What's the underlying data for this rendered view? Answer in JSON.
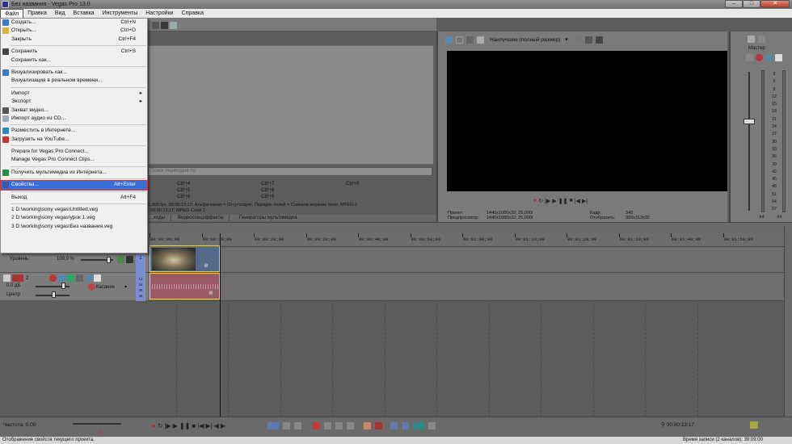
{
  "window": {
    "title": "Без названия - Vegas Pro 13.0",
    "minimize": "–",
    "maximize": "□",
    "close": "✕"
  },
  "menubar": [
    "Файл",
    "Правка",
    "Вид",
    "Вставка",
    "Инструменты",
    "Настройки",
    "Справка"
  ],
  "file_menu": {
    "items": [
      {
        "label": "Создать...",
        "shortcut": "Ctrl+N",
        "icon": "new-doc-icon"
      },
      {
        "label": "Открыть...",
        "shortcut": "Ctrl+O",
        "icon": "open-folder-icon"
      },
      {
        "label": "Закрыть",
        "shortcut": "Ctrl+F4"
      },
      {
        "sep": true
      },
      {
        "label": "Сохранить",
        "shortcut": "Ctrl+S",
        "icon": "save-icon"
      },
      {
        "label": "Сохранить как..."
      },
      {
        "sep": true
      },
      {
        "label": "Визуализировать как...",
        "icon": "render-icon"
      },
      {
        "label": "Визуализация в реальном времени..."
      },
      {
        "sep": true
      },
      {
        "label": "Импорт",
        "submenu": true
      },
      {
        "label": "Экспорт",
        "submenu": true
      },
      {
        "label": "Захват видео...",
        "icon": "capture-icon"
      },
      {
        "label": "Импорт аудио из CD...",
        "icon": "cd-icon"
      },
      {
        "sep": true
      },
      {
        "label": "Разместить в Интернете...",
        "icon": "web-icon"
      },
      {
        "label": "Загрузить на YouTube...",
        "icon": "youtube-icon"
      },
      {
        "sep": true
      },
      {
        "label": "Prepare for Vegas Pro Connect..."
      },
      {
        "label": "Manage Vegas Pro Connect Clips..."
      },
      {
        "sep": true
      },
      {
        "label": "Получить мультимедиа из Интернета...",
        "icon": "download-icon"
      },
      {
        "sep": true
      },
      {
        "label": "Свойства...",
        "shortcut": "Alt+Enter",
        "icon": "properties-icon",
        "highlight": true
      },
      {
        "sep": true
      },
      {
        "label": "Выход",
        "shortcut": "Alt+F4"
      },
      {
        "sep": true
      },
      {
        "label": "1 D:\\working\\sony vegas\\Untitled.veg"
      },
      {
        "label": "2 D:\\working\\sony vegas\\урок 1.veg"
      },
      {
        "label": "3 D:\\working\\sony vegas\\Без названия.veg"
      }
    ]
  },
  "explorer": {
    "search_placeholder": "Поиск переходов по",
    "shortcuts": [
      [
        "Ctrl+4",
        "Ctrl+7",
        "Ctrl+0"
      ],
      [
        "Ctrl+5",
        "Ctrl+8",
        ""
      ],
      [
        "Ctrl+6",
        "Ctrl+9",
        ""
      ]
    ],
    "info_line1": "5,000 fps; 00:00:13;17; Альфа-канал = Отсутствует; Порядок полей = Сначала верхнее поле; MPEG-2",
    "info_line2": "; 00:00:13;17; MPEG Слой 2",
    "tabs": [
      "...ходы",
      "Видеоспецэффекты",
      "Генераторы мультимедиа"
    ]
  },
  "preview": {
    "quality": "Наилучшее (полный размер)",
    "project_label": "Проект:",
    "project_value": "1440x1080x32; 25,000i",
    "preview_label": "Предпросмотр:",
    "preview_value": "1440x1080x32; 25,000i",
    "frame_label": "Кадр:",
    "frame_value": "340",
    "display_label": "Отобразить:",
    "display_value": "389x313x32"
  },
  "master": {
    "title": "Мастер",
    "scale": [
      "3",
      "6",
      "9",
      "12",
      "15",
      "18",
      "21",
      "24",
      "27",
      "30",
      "33",
      "36",
      "39",
      "42",
      "45",
      "48",
      "51",
      "54",
      "57"
    ],
    "levels": [
      "-Inf.",
      "-Inf."
    ]
  },
  "timeline": {
    "timecode": "00:00:13;17",
    "ruler": [
      "00:00:00;00",
      "00:00:10;00",
      "00:00:20;00",
      "00:00:30;00",
      "00:00:40;00",
      "00:00:50;00",
      "00:01:00;00",
      "00:01:10;00",
      "00:01:20;00",
      "00:01:30;00",
      "00:01:40;00",
      "00:01:50;00"
    ],
    "video_track": {
      "num": "1",
      "level_label": "Уровень:",
      "level_value": "100,0 %"
    },
    "audio_track": {
      "num": "2",
      "volume": "0,0 дБ",
      "pan": "Центр",
      "mode": "Касание",
      "meter": [
        "12",
        "24",
        "36",
        "48"
      ]
    }
  },
  "status": {
    "rate": "Частота: 0,00",
    "message": "Отображение свойств текущего проекта.",
    "record_time": "Время записи (2 каналов): 39:09:00",
    "cursor_time": "00:00:13;17",
    "right_time": "00:00:13;17"
  }
}
